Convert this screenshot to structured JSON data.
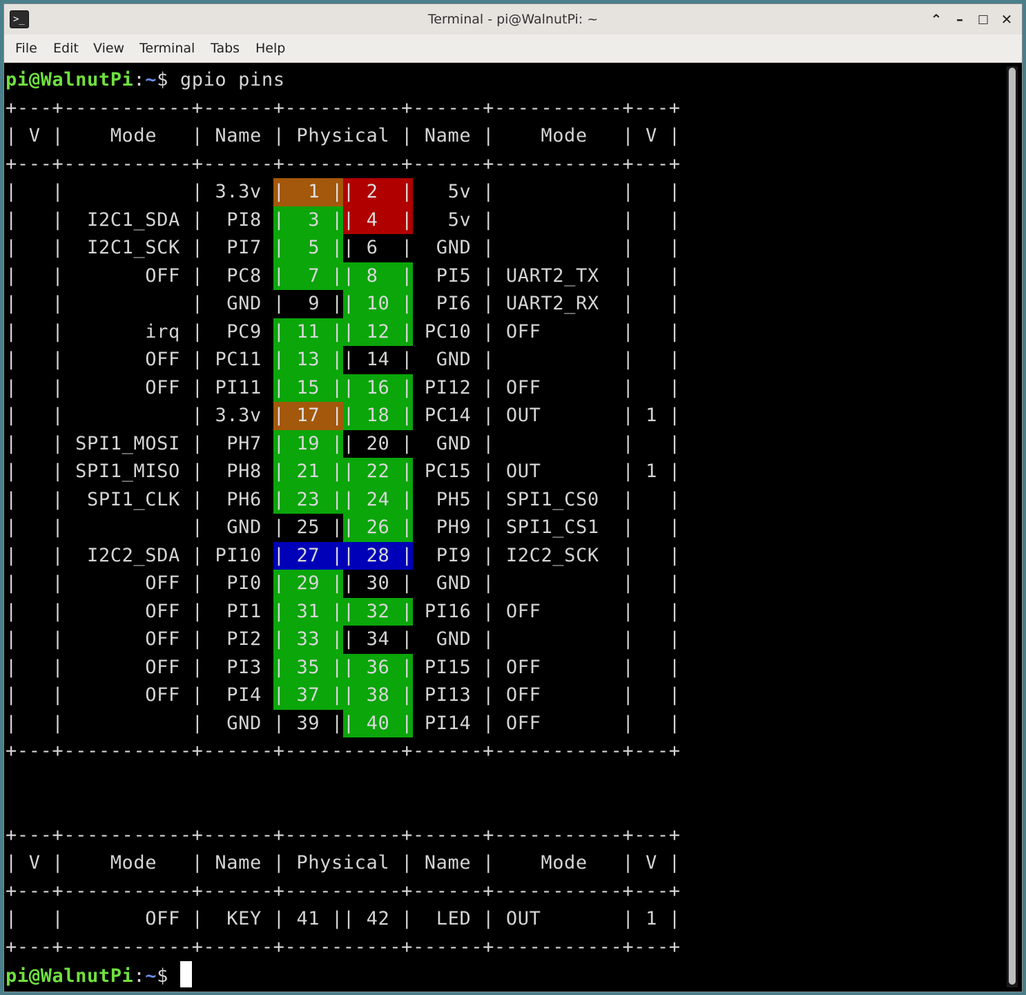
{
  "window": {
    "title": "Terminal - pi@WalnutPi: ~"
  },
  "menu": [
    "File",
    "Edit",
    "View",
    "Terminal",
    "Tabs",
    "Help"
  ],
  "prompt": {
    "user": "pi@WalnutPi",
    "sep": ":",
    "path": "~",
    "dollar": "$ "
  },
  "command": "gpio pins",
  "table": {
    "border": "+---+-----------+------+----------+------+-----------+---+",
    "header": "| V |    Mode   | Name | Physical | Name |    Mode   | V |",
    "rows": [
      {
        "v1": "",
        "mode1": "",
        "name1": "3.3v",
        "p1": "1",
        "p2": "2",
        "name2": "5v",
        "mode2": "",
        "v2": "",
        "c1": "orange",
        "c2": "red"
      },
      {
        "v1": "",
        "mode1": "I2C1_SDA",
        "name1": "PI8",
        "p1": "3",
        "p2": "4",
        "name2": "5v",
        "mode2": "",
        "v2": "",
        "c1": "green",
        "c2": "red"
      },
      {
        "v1": "",
        "mode1": "I2C1_SCK",
        "name1": "PI7",
        "p1": "5",
        "p2": "6",
        "name2": "GND",
        "mode2": "",
        "v2": "",
        "c1": "green",
        "c2": ""
      },
      {
        "v1": "",
        "mode1": "OFF",
        "name1": "PC8",
        "p1": "7",
        "p2": "8",
        "name2": "PI5",
        "mode2": "UART2_TX",
        "v2": "",
        "c1": "green",
        "c2": "green"
      },
      {
        "v1": "",
        "mode1": "",
        "name1": "GND",
        "p1": "9",
        "p2": "10",
        "name2": "PI6",
        "mode2": "UART2_RX",
        "v2": "",
        "c1": "",
        "c2": "green"
      },
      {
        "v1": "",
        "mode1": "irq",
        "name1": "PC9",
        "p1": "11",
        "p2": "12",
        "name2": "PC10",
        "mode2": "OFF",
        "v2": "",
        "c1": "green",
        "c2": "green"
      },
      {
        "v1": "",
        "mode1": "OFF",
        "name1": "PC11",
        "p1": "13",
        "p2": "14",
        "name2": "GND",
        "mode2": "",
        "v2": "",
        "c1": "green",
        "c2": ""
      },
      {
        "v1": "",
        "mode1": "OFF",
        "name1": "PI11",
        "p1": "15",
        "p2": "16",
        "name2": "PI12",
        "mode2": "OFF",
        "v2": "",
        "c1": "green",
        "c2": "green"
      },
      {
        "v1": "",
        "mode1": "",
        "name1": "3.3v",
        "p1": "17",
        "p2": "18",
        "name2": "PC14",
        "mode2": "OUT",
        "v2": "1",
        "c1": "orange",
        "c2": "green"
      },
      {
        "v1": "",
        "mode1": "SPI1_MOSI",
        "name1": "PH7",
        "p1": "19",
        "p2": "20",
        "name2": "GND",
        "mode2": "",
        "v2": "",
        "c1": "green",
        "c2": ""
      },
      {
        "v1": "",
        "mode1": "SPI1_MISO",
        "name1": "PH8",
        "p1": "21",
        "p2": "22",
        "name2": "PC15",
        "mode2": "OUT",
        "v2": "1",
        "c1": "green",
        "c2": "green"
      },
      {
        "v1": "",
        "mode1": "SPI1_CLK",
        "name1": "PH6",
        "p1": "23",
        "p2": "24",
        "name2": "PH5",
        "mode2": "SPI1_CS0",
        "v2": "",
        "c1": "green",
        "c2": "green"
      },
      {
        "v1": "",
        "mode1": "",
        "name1": "GND",
        "p1": "25",
        "p2": "26",
        "name2": "PH9",
        "mode2": "SPI1_CS1",
        "v2": "",
        "c1": "",
        "c2": "green"
      },
      {
        "v1": "",
        "mode1": "I2C2_SDA",
        "name1": "PI10",
        "p1": "27",
        "p2": "28",
        "name2": "PI9",
        "mode2": "I2C2_SCK",
        "v2": "",
        "c1": "blue",
        "c2": "blue"
      },
      {
        "v1": "",
        "mode1": "OFF",
        "name1": "PI0",
        "p1": "29",
        "p2": "30",
        "name2": "GND",
        "mode2": "",
        "v2": "",
        "c1": "green",
        "c2": ""
      },
      {
        "v1": "",
        "mode1": "OFF",
        "name1": "PI1",
        "p1": "31",
        "p2": "32",
        "name2": "PI16",
        "mode2": "OFF",
        "v2": "",
        "c1": "green",
        "c2": "green"
      },
      {
        "v1": "",
        "mode1": "OFF",
        "name1": "PI2",
        "p1": "33",
        "p2": "34",
        "name2": "GND",
        "mode2": "",
        "v2": "",
        "c1": "green",
        "c2": ""
      },
      {
        "v1": "",
        "mode1": "OFF",
        "name1": "PI3",
        "p1": "35",
        "p2": "36",
        "name2": "PI15",
        "mode2": "OFF",
        "v2": "",
        "c1": "green",
        "c2": "green"
      },
      {
        "v1": "",
        "mode1": "OFF",
        "name1": "PI4",
        "p1": "37",
        "p2": "38",
        "name2": "PI13",
        "mode2": "OFF",
        "v2": "",
        "c1": "green",
        "c2": "green"
      },
      {
        "v1": "",
        "mode1": "",
        "name1": "GND",
        "p1": "39",
        "p2": "40",
        "name2": "PI14",
        "mode2": "OFF",
        "v2": "",
        "c1": "",
        "c2": "green"
      }
    ],
    "rows2": [
      {
        "v1": "",
        "mode1": "OFF",
        "name1": "KEY",
        "p1": "41",
        "p2": "42",
        "name2": "LED",
        "mode2": "OUT",
        "v2": "1",
        "c1": "",
        "c2": ""
      }
    ]
  },
  "colors": {
    "green": "#0aa60a",
    "orange": "#a3580b",
    "red": "#b10000",
    "blue": "#0000b8"
  }
}
